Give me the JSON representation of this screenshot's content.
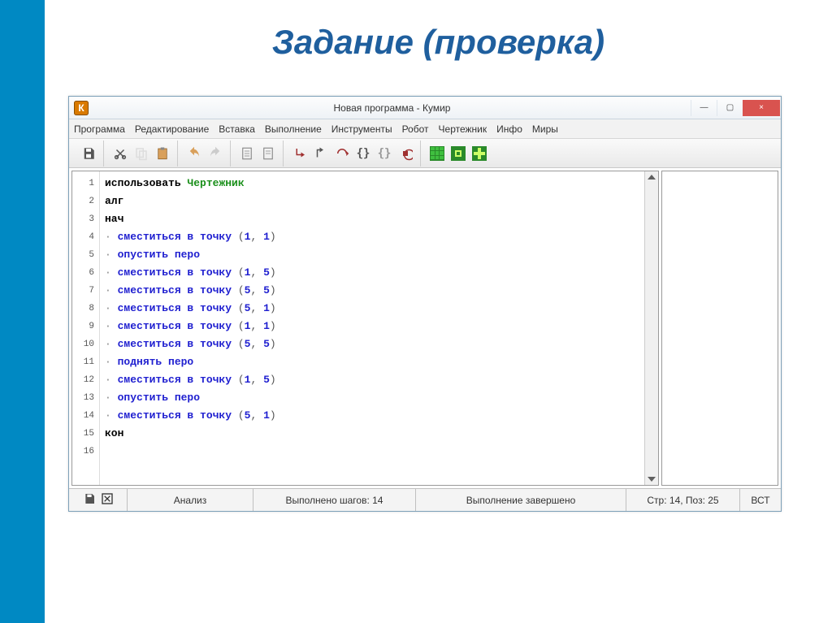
{
  "slide_title": "Задание (проверка)",
  "window": {
    "title": "Новая программа - Кумир",
    "app_icon_letter": "К",
    "win_min": "—",
    "win_max": "▢",
    "win_close": "×"
  },
  "menu": {
    "items": [
      "Программа",
      "Редактирование",
      "Вставка",
      "Выполнение",
      "Инструменты",
      "Робот",
      "Чертежник",
      "Инфо",
      "Миры"
    ]
  },
  "code": {
    "lines": [
      {
        "n": 1,
        "tokens": [
          {
            "t": "использовать",
            "c": "kw-black"
          },
          {
            "t": " "
          },
          {
            "t": "Чертежник",
            "c": "kw-green"
          }
        ]
      },
      {
        "n": 2,
        "tokens": [
          {
            "t": "алг",
            "c": "kw-black"
          }
        ]
      },
      {
        "n": 3,
        "tokens": [
          {
            "t": "нач",
            "c": "kw-black"
          }
        ]
      },
      {
        "n": 4,
        "tokens": [
          {
            "t": "· ",
            "c": "dot"
          },
          {
            "t": "сместиться в точку",
            "c": "kw-blue"
          },
          {
            "t": " (",
            "c": "paren"
          },
          {
            "t": "1",
            "c": "num"
          },
          {
            "t": ", ",
            "c": "paren"
          },
          {
            "t": "1",
            "c": "num"
          },
          {
            "t": ")",
            "c": "paren"
          }
        ]
      },
      {
        "n": 5,
        "tokens": [
          {
            "t": "· ",
            "c": "dot"
          },
          {
            "t": "опустить перо",
            "c": "kw-blue"
          }
        ]
      },
      {
        "n": 6,
        "tokens": [
          {
            "t": "· ",
            "c": "dot"
          },
          {
            "t": "сместиться в точку",
            "c": "kw-blue"
          },
          {
            "t": " (",
            "c": "paren"
          },
          {
            "t": "1",
            "c": "num"
          },
          {
            "t": ", ",
            "c": "paren"
          },
          {
            "t": "5",
            "c": "num"
          },
          {
            "t": ")",
            "c": "paren"
          }
        ]
      },
      {
        "n": 7,
        "tokens": [
          {
            "t": "· ",
            "c": "dot"
          },
          {
            "t": "сместиться в точку",
            "c": "kw-blue"
          },
          {
            "t": " (",
            "c": "paren"
          },
          {
            "t": "5",
            "c": "num"
          },
          {
            "t": ", ",
            "c": "paren"
          },
          {
            "t": "5",
            "c": "num"
          },
          {
            "t": ")",
            "c": "paren"
          }
        ]
      },
      {
        "n": 8,
        "tokens": [
          {
            "t": "· ",
            "c": "dot"
          },
          {
            "t": "сместиться в точку",
            "c": "kw-blue"
          },
          {
            "t": " (",
            "c": "paren"
          },
          {
            "t": "5",
            "c": "num"
          },
          {
            "t": ", ",
            "c": "paren"
          },
          {
            "t": "1",
            "c": "num"
          },
          {
            "t": ")",
            "c": "paren"
          }
        ]
      },
      {
        "n": 9,
        "tokens": [
          {
            "t": "· ",
            "c": "dot"
          },
          {
            "t": "сместиться в точку",
            "c": "kw-blue"
          },
          {
            "t": " (",
            "c": "paren"
          },
          {
            "t": "1",
            "c": "num"
          },
          {
            "t": ", ",
            "c": "paren"
          },
          {
            "t": "1",
            "c": "num"
          },
          {
            "t": ")",
            "c": "paren"
          }
        ]
      },
      {
        "n": 10,
        "tokens": [
          {
            "t": "· ",
            "c": "dot"
          },
          {
            "t": "сместиться в точку",
            "c": "kw-blue"
          },
          {
            "t": " (",
            "c": "paren"
          },
          {
            "t": "5",
            "c": "num"
          },
          {
            "t": ", ",
            "c": "paren"
          },
          {
            "t": "5",
            "c": "num"
          },
          {
            "t": ")",
            "c": "paren"
          }
        ]
      },
      {
        "n": 11,
        "tokens": [
          {
            "t": "· ",
            "c": "dot"
          },
          {
            "t": "поднять перо",
            "c": "kw-blue"
          }
        ]
      },
      {
        "n": 12,
        "tokens": [
          {
            "t": "· ",
            "c": "dot"
          },
          {
            "t": "сместиться в точку",
            "c": "kw-blue"
          },
          {
            "t": " (",
            "c": "paren"
          },
          {
            "t": "1",
            "c": "num"
          },
          {
            "t": ", ",
            "c": "paren"
          },
          {
            "t": "5",
            "c": "num"
          },
          {
            "t": ")",
            "c": "paren"
          }
        ]
      },
      {
        "n": 13,
        "tokens": [
          {
            "t": "· ",
            "c": "dot"
          },
          {
            "t": "опустить перо",
            "c": "kw-blue"
          }
        ]
      },
      {
        "n": 14,
        "tokens": [
          {
            "t": "· ",
            "c": "dot"
          },
          {
            "t": "сместиться в точку",
            "c": "kw-blue"
          },
          {
            "t": " (",
            "c": "paren"
          },
          {
            "t": "5",
            "c": "num"
          },
          {
            "t": ", ",
            "c": "paren"
          },
          {
            "t": "1",
            "c": "num"
          },
          {
            "t": ")",
            "c": "paren"
          }
        ]
      },
      {
        "n": 15,
        "tokens": [
          {
            "t": "кон",
            "c": "kw-black"
          }
        ]
      },
      {
        "n": 16,
        "tokens": []
      }
    ]
  },
  "status": {
    "analysis": "Анализ",
    "steps": "Выполнено шагов: 14",
    "execution": "Выполнение завершено",
    "cursor": "Стр: 14, Поз: 25",
    "mode": "ВСТ"
  }
}
